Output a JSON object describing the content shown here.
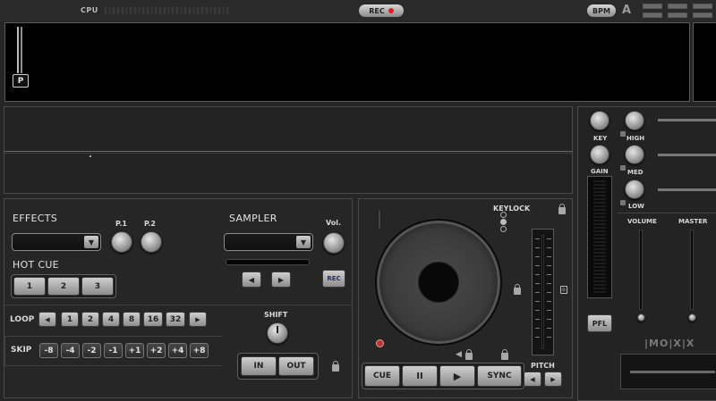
{
  "top": {
    "cpu_label": "CPU",
    "rec_label": "REC",
    "bpm_label": "BPM",
    "a_label": "A"
  },
  "waveform": {
    "p_label": "P"
  },
  "effects": {
    "title": "EFFECTS",
    "p1_label": "P.1",
    "p2_label": "P.2"
  },
  "sampler": {
    "title": "SAMPLER",
    "vol_label": "Vol.",
    "rec_label": "REC"
  },
  "hotcue": {
    "title": "HOT CUE",
    "buttons": [
      "1",
      "2",
      "3"
    ]
  },
  "loop": {
    "label": "LOOP",
    "buttons": [
      "1",
      "2",
      "4",
      "8",
      "16",
      "32"
    ]
  },
  "skip": {
    "label": "SKIP",
    "buttons": [
      "-8",
      "-4",
      "-2",
      "-1",
      "+1",
      "+2",
      "+4",
      "+8"
    ]
  },
  "shift": {
    "label": "SHIFT",
    "in_label": "IN",
    "out_label": "OUT"
  },
  "deck": {
    "keylock_label": "KEYLOCK",
    "cue_label": "CUE",
    "pause_label": "II",
    "play_label": "▶",
    "sync_label": "SYNC",
    "pitch_label": "PITCH"
  },
  "mixer": {
    "key_label": "KEY",
    "high_label": "HIGH",
    "gain_label": "GAIN",
    "med_label": "MED",
    "low_label": "LOW",
    "volume_label": "VOLUME",
    "master_label": "MASTER",
    "pfl_label": "PFL",
    "crossfader_logo": "|MO|X|X"
  },
  "colors": {
    "rec_dot": "#e02020",
    "background": "#262626",
    "button_silver": "#cfcfcf"
  }
}
